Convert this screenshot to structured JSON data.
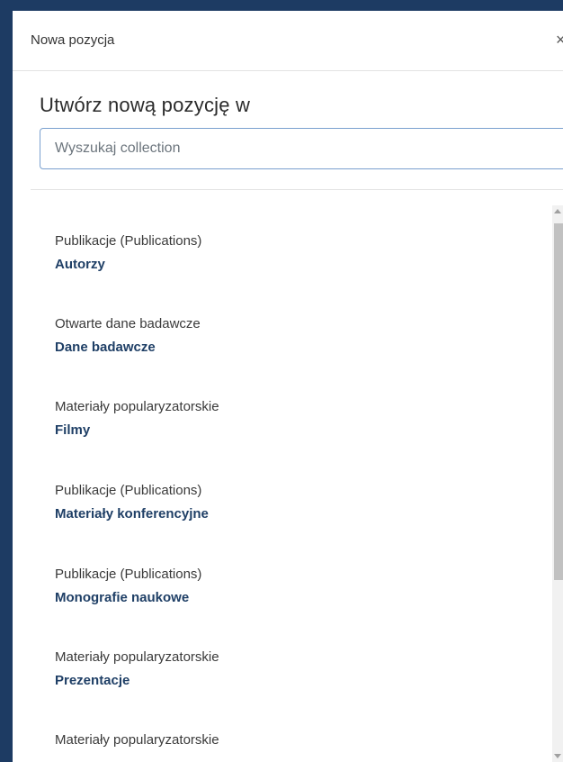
{
  "modal": {
    "title": "Nowa pozycja",
    "close_symbol": "×",
    "heading": "Utwórz nową pozycję w",
    "search": {
      "placeholder": "Wyszukaj collection",
      "value": ""
    }
  },
  "collections": [
    {
      "parent": "Publikacje (Publications)",
      "name": "Autorzy"
    },
    {
      "parent": "Otwarte dane badawcze",
      "name": "Dane badawcze"
    },
    {
      "parent": "Materiały popularyzatorskie",
      "name": "Filmy"
    },
    {
      "parent": "Publikacje (Publications)",
      "name": "Materiały konferencyjne"
    },
    {
      "parent": "Publikacje (Publications)",
      "name": "Monografie naukowe"
    },
    {
      "parent": "Materiały popularyzatorskie",
      "name": "Prezentacje"
    },
    {
      "parent": "Materiały popularyzatorskie",
      "name": ""
    }
  ],
  "colors": {
    "backdrop": "#1d3b63",
    "link": "#1f3f66",
    "input_border": "#7aa0cf"
  }
}
